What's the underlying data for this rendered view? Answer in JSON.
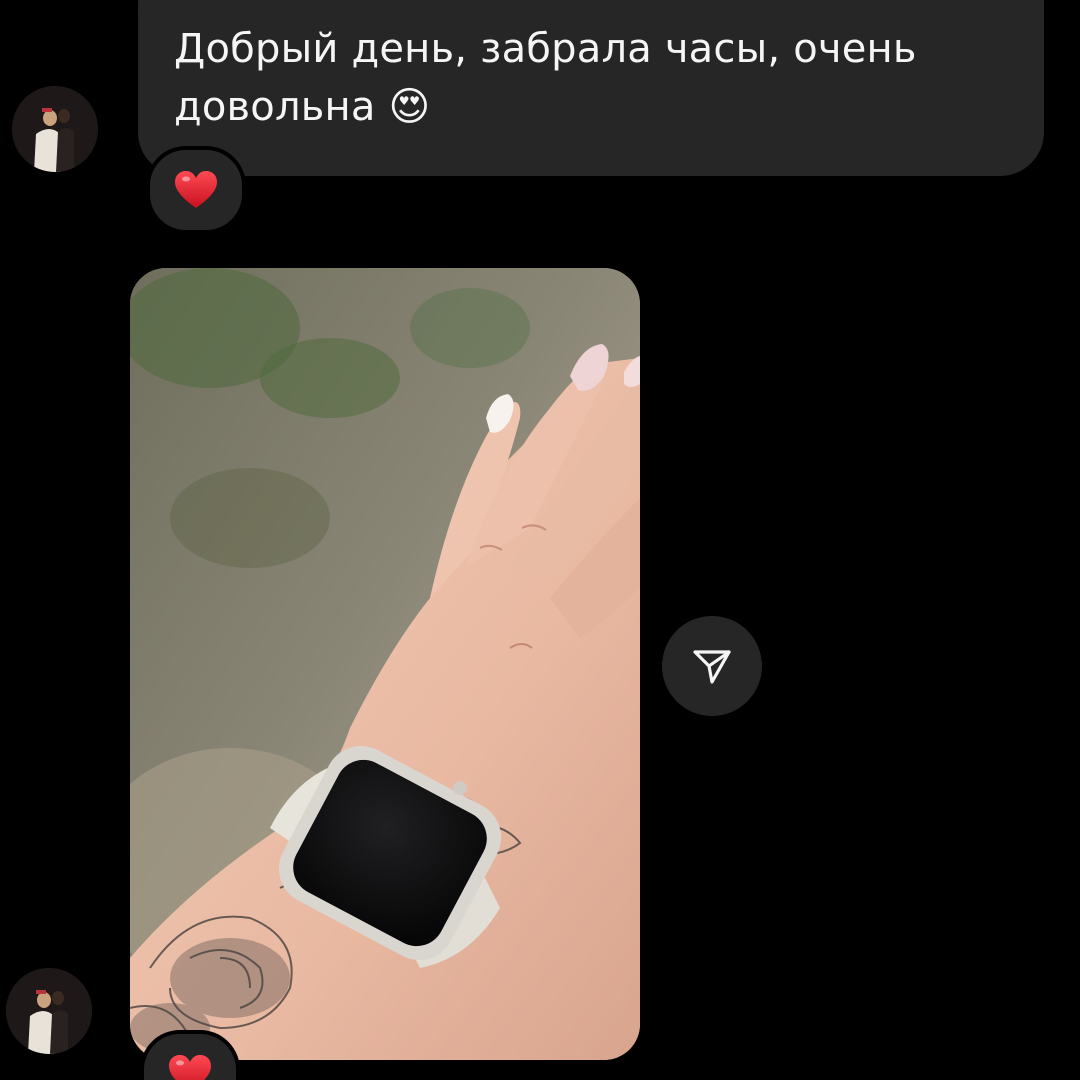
{
  "thread": {
    "messages": [
      {
        "type": "text",
        "text": "Добрый день, забрала часы, очень довольна 😍",
        "reaction": "❤️"
      },
      {
        "type": "photo",
        "reaction": "❤️"
      }
    ]
  },
  "icons": {
    "share": "paper-plane-icon",
    "reaction": "red-heart-icon",
    "avatar": "user-avatar"
  },
  "colors": {
    "background": "#000000",
    "bubble": "#262626",
    "text": "#f5f5f5",
    "heart": "#e0202e"
  }
}
